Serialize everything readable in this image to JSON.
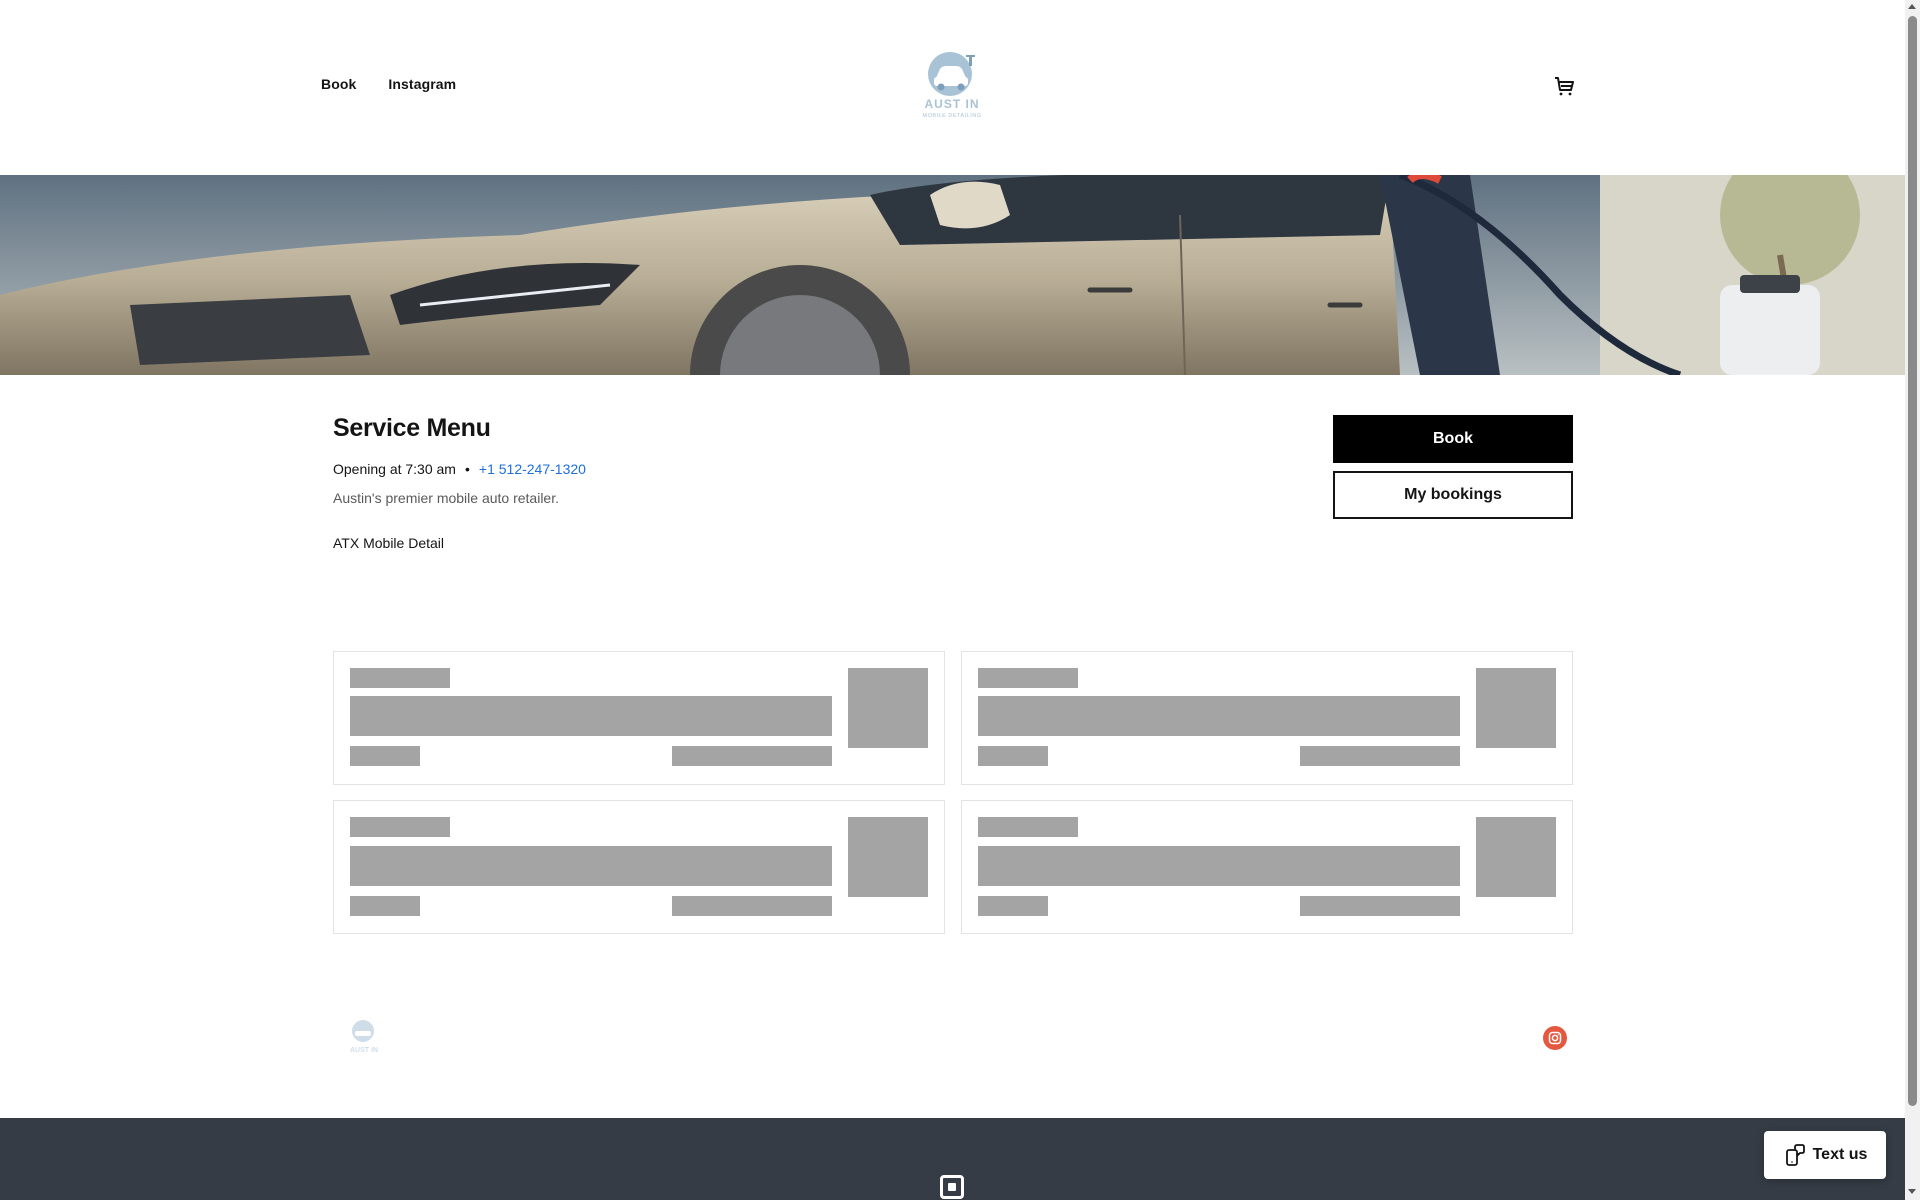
{
  "header": {
    "nav": [
      {
        "label": "Book"
      },
      {
        "label": "Instagram"
      }
    ],
    "logo": {
      "line1": "AUST IN",
      "line2": "MOBILE DETAILING"
    }
  },
  "main": {
    "title": "Service Menu",
    "hours": "Opening at 7:30 am",
    "separator": "•",
    "phone": "+1 512-247-1320",
    "description": "Austin's premier mobile auto retailer.",
    "business_name": "ATX Mobile Detail",
    "book_label": "Book",
    "my_bookings_label": "My bookings"
  },
  "footer": {
    "logo": {
      "line1": "AUST IN"
    },
    "text_us_label": "Text us"
  },
  "colors": {
    "accent_link": "#1e6fe0",
    "button_primary": "#000000",
    "footer_dark": "#353c45",
    "instagram": "#e4583f",
    "skeleton": "#a4a4a4"
  },
  "icons": [
    "cart-icon",
    "instagram-icon",
    "chat-phone-icon",
    "square-logo-icon"
  ]
}
